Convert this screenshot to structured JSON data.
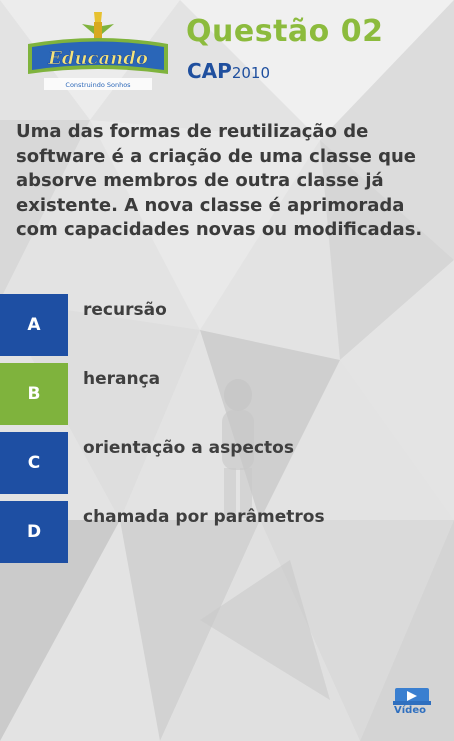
{
  "header": {
    "logo_text": "Educando",
    "logo_subtext": "Construindo Sonhos",
    "title": "Questão 02",
    "exam": "CAP",
    "year": "2010"
  },
  "question": {
    "text": "Uma das formas de reutilização de software é a criação de uma classe que absorve membros de outra classe já existente. A nova classe é aprimorada com capacidades novas ou modificadas."
  },
  "options": [
    {
      "letter": "A",
      "text": "recursão"
    },
    {
      "letter": "B",
      "text": "herança"
    },
    {
      "letter": "C",
      "text": "orientação a aspectos"
    },
    {
      "letter": "D",
      "text": "chamada por parâmetros"
    }
  ],
  "video": {
    "label": "Vídeo"
  },
  "colors": {
    "blue": "#1e4fa3",
    "green": "#7fb33d",
    "title_green": "#8cbb3d",
    "cap_blue": "#1f4f9e"
  }
}
